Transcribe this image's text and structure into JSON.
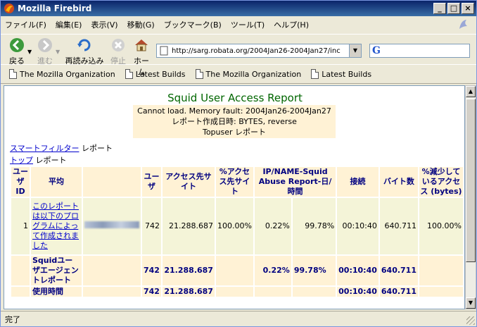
{
  "window": {
    "title": "Mozilla Firebird",
    "controls": [
      "_",
      "□",
      "×"
    ]
  },
  "menu": [
    "ファイル(F)",
    "編集(E)",
    "表示(V)",
    "移動(G)",
    "ブックマーク(B)",
    "ツール(T)",
    "ヘルプ(H)"
  ],
  "toolbar": {
    "back": "戻る",
    "forward": "進む",
    "reload": "再読み込み",
    "stop": "停止",
    "home": "ホーム",
    "url": "http://sarg.robata.org/2004Jan26-2004Jan27/inc",
    "search_placeholder": ""
  },
  "bookmarks": [
    "The Mozilla Organization",
    "Latest Builds",
    "The Mozilla Organization",
    "Latest Builds"
  ],
  "report": {
    "title": "Squid User Access Report",
    "info": [
      "Cannot load. Memory fault: 2004Jan26-2004Jan27",
      "レポート作成日時: BYTES, reverse",
      "Topuser レポート"
    ],
    "nav1_link": "スマートフィルター",
    "nav1_text": " レポート",
    "nav2_link": "トップ",
    "nav2_text": " レポート",
    "headers": [
      "ユーザID",
      "平均",
      "ユーザ",
      "アクセス先サイト",
      "%アクセス先サイト",
      "IP/NAME-Squid Abuse Report-日/時間",
      "接続",
      "バイト数",
      "%減少しているアクセス (bytes)"
    ],
    "row": {
      "num": "1",
      "note": "このレポートは以下のプログラムによって作成されました",
      "users": "742",
      "sites": "21.288.687",
      "pct_sites": "100.00%",
      "v1": "0.22%",
      "v2": "99.78%",
      "time": "00:10:40",
      "bytes": "640.711",
      "pct_bytes": "100.00%"
    },
    "total": {
      "label": "Squidユーザエージェントレポート",
      "users": "742",
      "sites": "21.288.687",
      "v1": "0.22%",
      "v2": "99.78%",
      "time": "00:10:40",
      "bytes": "640.711"
    },
    "usage": {
      "label": "使用時間",
      "users": "742",
      "sites": "21.288.687",
      "time": "00:10:40",
      "bytes": "640.711"
    }
  },
  "status": "完了"
}
